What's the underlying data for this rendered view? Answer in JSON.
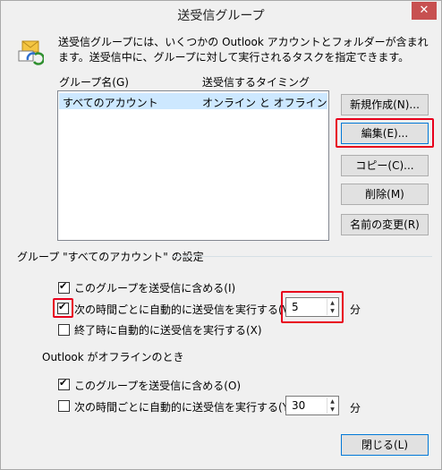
{
  "window": {
    "title": "送受信グループ",
    "close_label": "✕"
  },
  "description": "送受信グループには、いくつかの Outlook アカウントとフォルダーが含まれます。送受信中に、グループに対して実行されるタスクを指定できます。",
  "list": {
    "col_group": "グループ名(G)",
    "col_timing": "送受信するタイミング",
    "rows": [
      {
        "name": "すべてのアカウント",
        "timing": "オンライン と オフライン"
      }
    ]
  },
  "buttons": {
    "new": "新規作成(N)...",
    "edit": "編集(E)...",
    "copy": "コピー(C)...",
    "delete": "削除(M)",
    "rename": "名前の変更(R)",
    "close": "閉じる(L)"
  },
  "settings_title": "グループ \"すべてのアカウント\" の設定",
  "online": {
    "include_label": "このグループを送受信に含める(I)",
    "auto_label": "次の時間ごとに自動的に送受信を実行する(V)",
    "auto_minutes": "5",
    "minutes_unit": "分",
    "exit_label": "終了時に自動的に送受信を実行する(X)"
  },
  "offline_title": "Outlook がオフラインのとき",
  "offline": {
    "include_label": "このグループを送受信に含める(O)",
    "auto_label": "次の時間ごとに自動的に送受信を実行する(Y)",
    "auto_minutes": "30",
    "minutes_unit": "分"
  },
  "colors": {
    "highlight": "#e8001c",
    "selection": "#cde8ff",
    "close_button": "#c75050"
  }
}
